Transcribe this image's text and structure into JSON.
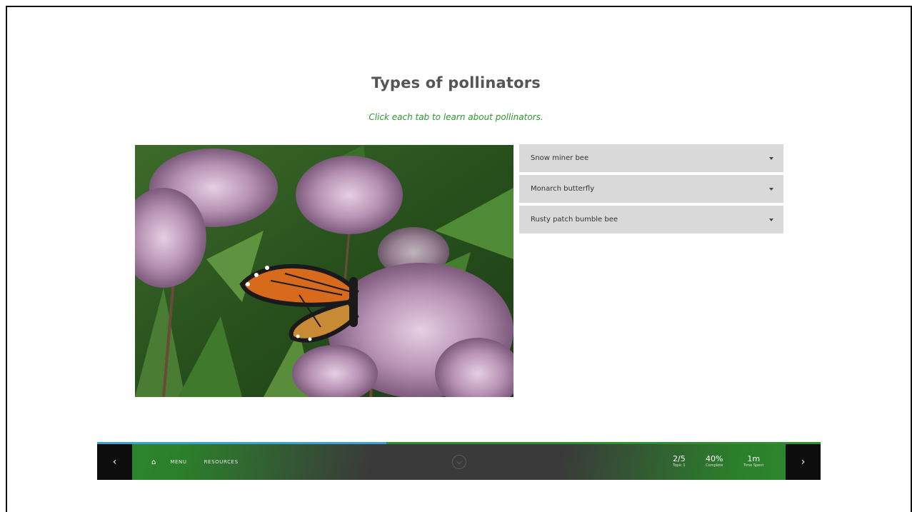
{
  "page": {
    "title": "Types of pollinators",
    "instruction": "Click each tab to learn about pollinators."
  },
  "accordion": {
    "items": [
      {
        "label": "Snow miner bee"
      },
      {
        "label": "Monarch butterfly"
      },
      {
        "label": "Rusty patch bumble bee"
      }
    ]
  },
  "navbar": {
    "prev_icon": "chevron-left-icon",
    "prev_glyph": "‹",
    "next_icon": "chevron-right-icon",
    "next_glyph": "›",
    "home_icon": "home-icon",
    "home_glyph": "⌂",
    "menu_label": "MENU",
    "resources_label": "RESOURCES",
    "progress_fraction": 0.4,
    "topic": {
      "value": "2/5",
      "label": "Topic 1"
    },
    "complete": {
      "value": "40%",
      "label": "Complete"
    },
    "time": {
      "value": "1m",
      "label": "Time Spent"
    }
  },
  "colors": {
    "accent_green": "#2a9a2a",
    "progress_blue": "#3aa0d8",
    "accordion_bg": "#d9d9d9"
  }
}
